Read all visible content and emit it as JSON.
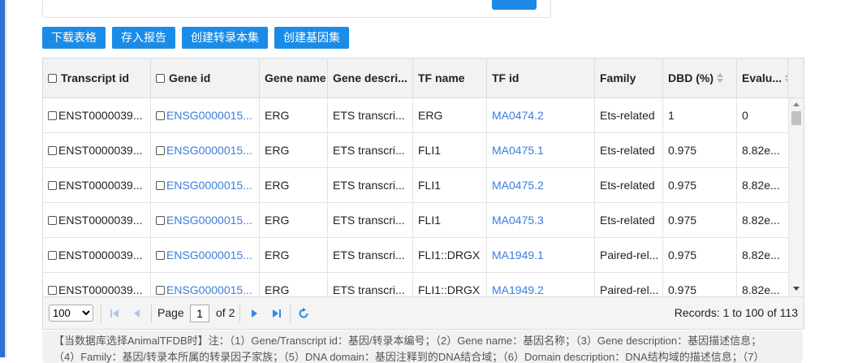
{
  "toolbar": {
    "buttons": [
      "下载表格",
      "存入报告",
      "创建转录本集",
      "创建基因集"
    ]
  },
  "table": {
    "headers": {
      "transcript_id": "Transcript id",
      "gene_id": "Gene id",
      "gene_name": "Gene name",
      "gene_description": "Gene descri...",
      "tf_name": "TF name",
      "tf_id": "TF id",
      "family": "Family",
      "dbd": "DBD (%)",
      "evalue": "Evalu..."
    },
    "rows": [
      {
        "transcript_id": "ENST0000039...",
        "gene_id": "ENSG0000015...",
        "gene_name": "ERG",
        "gene_description": "ETS transcri...",
        "tf_name": "ERG",
        "tf_id": "MA0474.2",
        "family": "Ets-related",
        "dbd": "1",
        "evalue": "0"
      },
      {
        "transcript_id": "ENST0000039...",
        "gene_id": "ENSG0000015...",
        "gene_name": "ERG",
        "gene_description": "ETS transcri...",
        "tf_name": "FLI1",
        "tf_id": "MA0475.1",
        "family": "Ets-related",
        "dbd": "0.975",
        "evalue": "8.82e..."
      },
      {
        "transcript_id": "ENST0000039...",
        "gene_id": "ENSG0000015...",
        "gene_name": "ERG",
        "gene_description": "ETS transcri...",
        "tf_name": "FLI1",
        "tf_id": "MA0475.2",
        "family": "Ets-related",
        "dbd": "0.975",
        "evalue": "8.82e..."
      },
      {
        "transcript_id": "ENST0000039...",
        "gene_id": "ENSG0000015...",
        "gene_name": "ERG",
        "gene_description": "ETS transcri...",
        "tf_name": "FLI1",
        "tf_id": "MA0475.3",
        "family": "Ets-related",
        "dbd": "0.975",
        "evalue": "8.82e..."
      },
      {
        "transcript_id": "ENST0000039...",
        "gene_id": "ENSG0000015...",
        "gene_name": "ERG",
        "gene_description": "ETS transcri...",
        "tf_name": "FLI1::DRGX",
        "tf_id": "MA1949.1",
        "family": "Paired-rel...",
        "dbd": "0.975",
        "evalue": "8.82e..."
      },
      {
        "transcript_id": "ENST0000039...",
        "gene_id": "ENSG0000015...",
        "gene_name": "ERG",
        "gene_description": "ETS transcri...",
        "tf_name": "FLI1::DRGX",
        "tf_id": "MA1949.2",
        "family": "Paired-rel...",
        "dbd": "0.975",
        "evalue": "8.82e..."
      }
    ]
  },
  "pager": {
    "page_size": "100",
    "page_size_options": [
      "100"
    ],
    "page_label": "Page",
    "current_page": "1",
    "of_label": "of 2",
    "records": "Records: 1 to 100 of 113"
  },
  "notes": {
    "line1": "【当数据库选择AnimalTFDB时】注：（1）Gene/Transcript id：基因/转录本编号；（2）Gene name：基因名称；（3）Gene description：基因描述信息；",
    "line2": "（4）Family：基因/转录本所属的转录因子家族；（5）DNA domain：基因注释到的DNA结合域；（6）Domain description：DNA结构域的描述信息；（7）"
  },
  "colors": {
    "accent": "#1a8ce8",
    "link": "#3b7ddd",
    "header_bg": "#f2f2f2",
    "pager_icon": "#2b8be6"
  }
}
